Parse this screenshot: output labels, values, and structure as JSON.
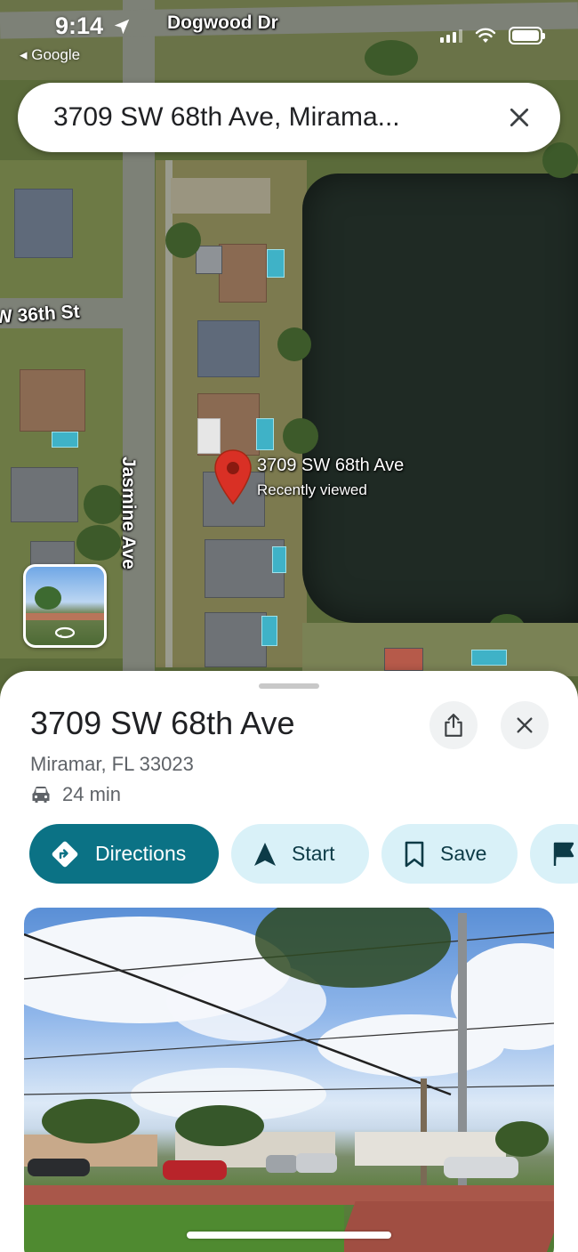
{
  "status_bar": {
    "time": "9:14",
    "back_label": "◂ Google"
  },
  "map": {
    "street_labels": {
      "top": "Dogwood Dr",
      "left": "W 36th St",
      "vertical": "Jasmine Ave"
    },
    "pin": {
      "title": "3709 SW 68th Ave",
      "subtitle": "Recently viewed"
    }
  },
  "search": {
    "value": "3709 SW 68th Ave, Mirama..."
  },
  "place": {
    "title": "3709 SW 68th Ave",
    "address": "Miramar, FL 33023",
    "eta": "24 min"
  },
  "actions": {
    "directions": "Directions",
    "start": "Start",
    "save": "Save"
  },
  "colors": {
    "primary": "#0b7285",
    "chip_bg": "#d9f1f8",
    "pin": "#d93025"
  }
}
